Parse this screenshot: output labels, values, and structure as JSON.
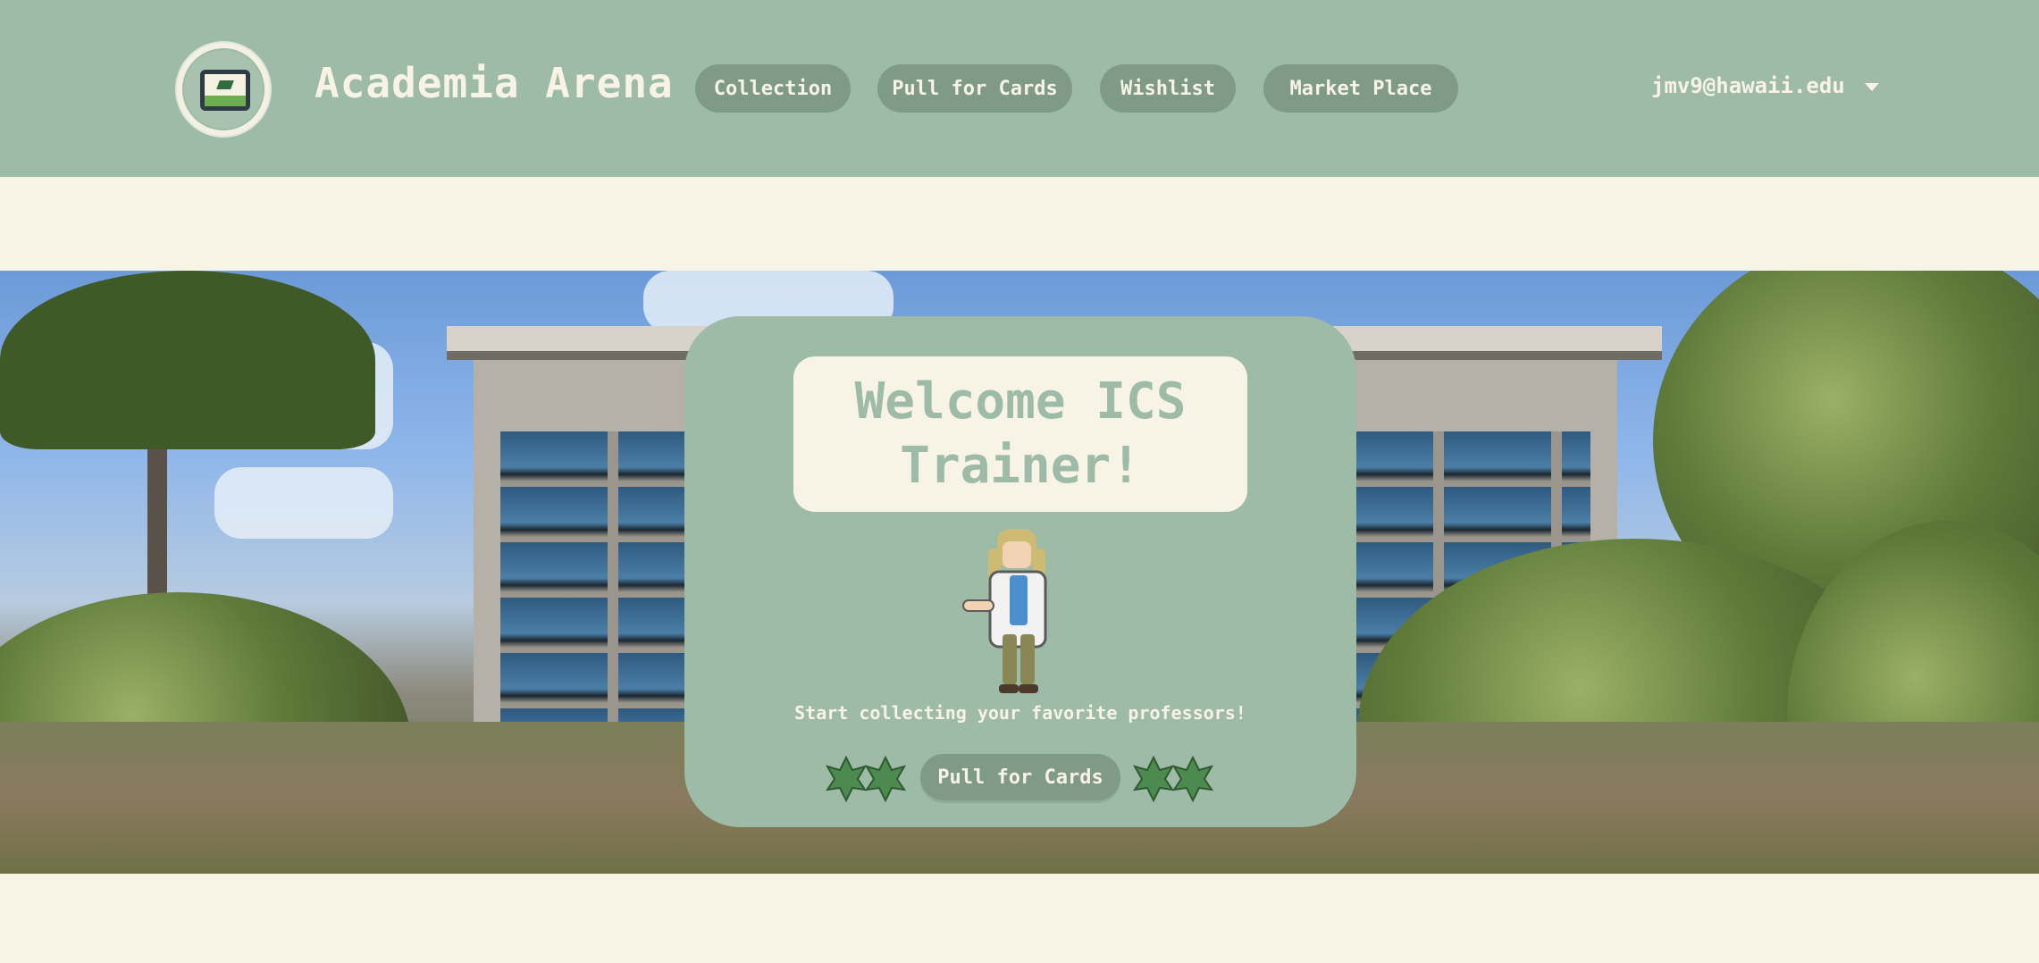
{
  "header": {
    "logo_text": "ACADEMIA ARENA",
    "brand": "Academia Arena",
    "nav": [
      {
        "label": "Collection"
      },
      {
        "label": "Pull for Cards"
      },
      {
        "label": "Wishlist"
      },
      {
        "label": "Market Place"
      }
    ],
    "user_email": "jmv9@hawaii.edu"
  },
  "hero": {
    "title": "Welcome ICS Trainer!",
    "tagline": "Start collecting your favorite professors!",
    "cta_label": "Pull for Cards"
  },
  "colors": {
    "primary": "#9dbba7",
    "pill": "#7f9b88",
    "background": "#f7f3e5"
  }
}
